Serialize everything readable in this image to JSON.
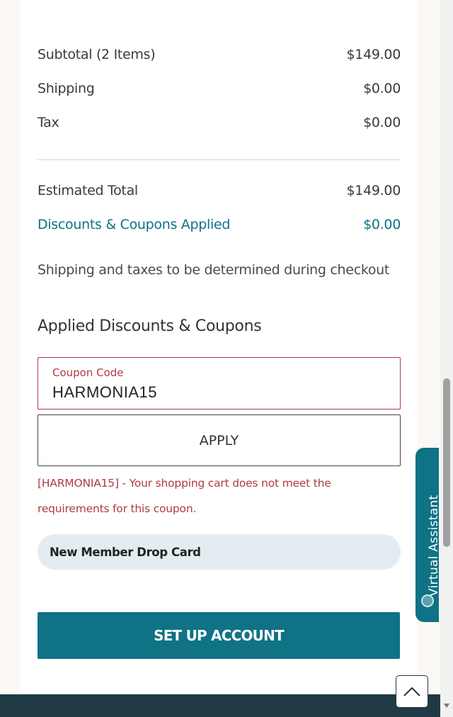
{
  "summary": {
    "subtotal_label": "Subtotal (2 Items)",
    "subtotal_value": "$149.00",
    "shipping_label": "Shipping",
    "shipping_value": "$0.00",
    "tax_label": "Tax",
    "tax_value": "$0.00",
    "estimated_total_label": "Estimated Total",
    "estimated_total_value": "$149.00",
    "discounts_label": "Discounts & Coupons Applied",
    "discounts_value": "$0.00",
    "note": "Shipping and taxes to be determined during checkout"
  },
  "coupons": {
    "section_title": "Applied Discounts & Coupons",
    "field_label": "Coupon Code",
    "field_value": "HARMONIA15",
    "apply_label": "APPLY",
    "error_message": "[HARMONIA15] - Your shopping cart does not meet the requirements for this coupon.",
    "drop_card_label": "New Member Drop Card"
  },
  "actions": {
    "setup_account_label": "SET UP ACCOUNT"
  },
  "assistant": {
    "tab_label": "Virtual Assistant",
    "icon": "globe-icon"
  },
  "icons": {
    "back_to_top": "chevron-up-icon"
  },
  "colors": {
    "brand_teal": "#0f7285",
    "error_red": "#b03a48",
    "pill_bg": "#e3edf1",
    "bottom_bar": "#1f3a45"
  }
}
